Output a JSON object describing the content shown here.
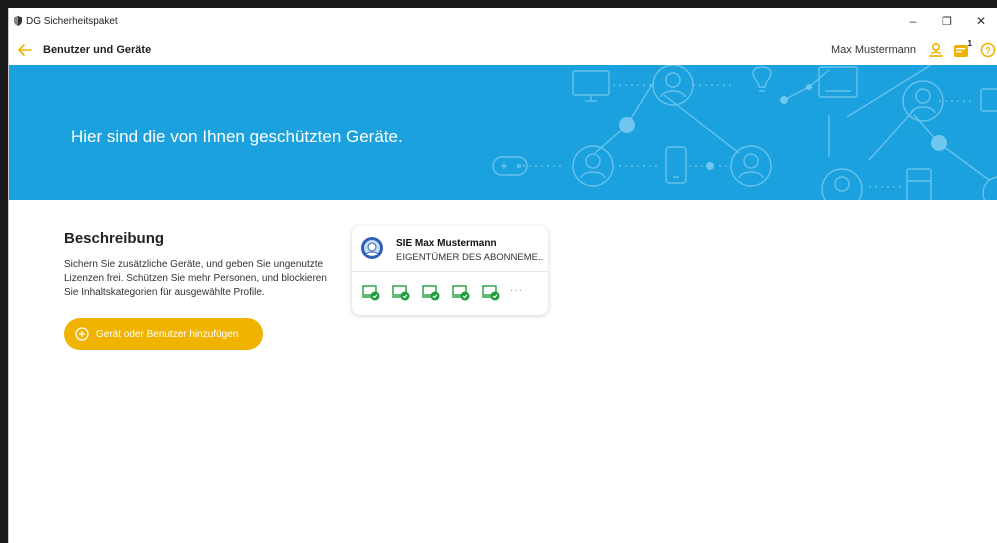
{
  "window": {
    "title": "DG Sicherheitspaket",
    "controls": {
      "minimize": "–",
      "restore": "❐",
      "close": "✕"
    }
  },
  "header": {
    "title": "Benutzer und Geräte",
    "user_name": "Max Mustermann",
    "icons": [
      "user-icon",
      "notification-card-icon",
      "help-icon"
    ],
    "notification_badge": "1"
  },
  "banner": {
    "headline": "Hier sind die von Ihnen geschützten Geräte.",
    "color": "#1ba1de"
  },
  "description": {
    "title": "Beschreibung",
    "lines": [
      "Sichern Sie zusätzliche Geräte, und geben Sie ungenutzte",
      "Lizenzen frei. Schützen Sie mehr Personen, und blockieren",
      "Sie Inhaltskategorien für ausgewählte Profile."
    ]
  },
  "add_button": {
    "label": "Gerät oder Benutzer hinzufügen",
    "color": "#f0b400"
  },
  "user_card": {
    "name": "SIE Max Mustermann",
    "role": "EIGENTÜMER DES ABONNEME...",
    "device_count": 5,
    "more": "···",
    "device_status_color": "#1e9e3a"
  },
  "colors": {
    "accent": "#f0b400",
    "banner": "#1ba1de",
    "protected": "#1e9e3a"
  }
}
